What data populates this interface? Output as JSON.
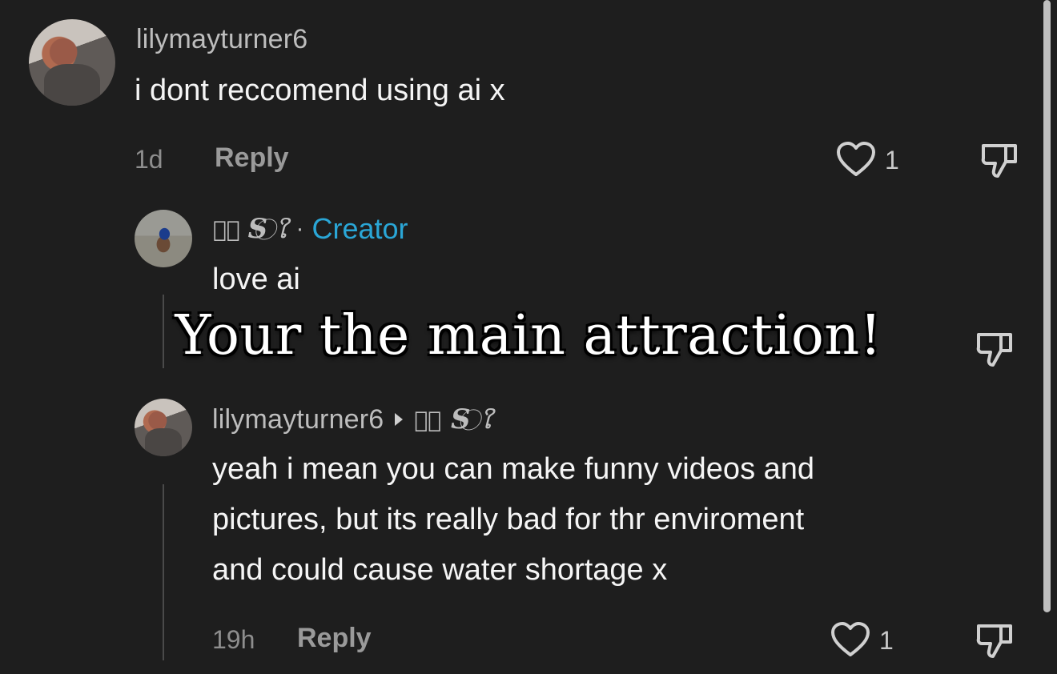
{
  "comments": [
    {
      "username": "lilymayturner6",
      "text": "i dont reccomend using ai x",
      "time": "1d",
      "reply_label": "Reply",
      "likes": "1"
    },
    {
      "username_deco_left": "ঌ⃝ ₍S₎ ⃝ໃ",
      "username": "S",
      "separator": "·",
      "creator_label": "Creator",
      "text": "love ai"
    },
    {
      "username": "lilymayturner6",
      "reply_to_name": "S",
      "text_line1": "yeah i mean you can make funny videos and",
      "text_line2": "pictures, but its really bad for thr enviroment",
      "text_line3": "and could cause water shortage x",
      "time": "19h",
      "reply_label": "Reply",
      "likes": "1"
    }
  ],
  "overlay_caption": "Your the main attraction!",
  "icons": {
    "like": "heart-outline-icon",
    "dislike": "thumbs-down-icon",
    "reply_arrow": "caret-right-icon"
  },
  "colors": {
    "background": "#1e1e1e",
    "creator_accent": "#2aa6d6"
  }
}
